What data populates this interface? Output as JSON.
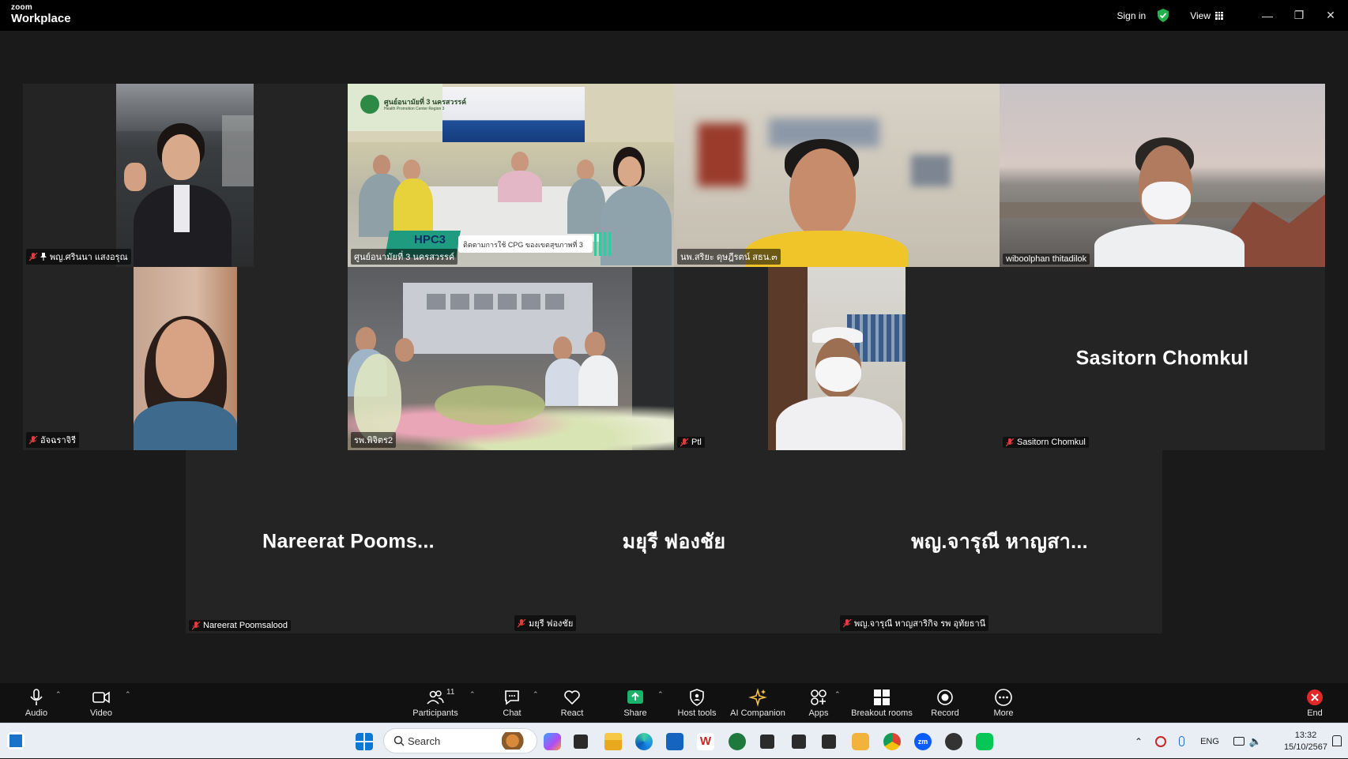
{
  "app": {
    "brand_top": "zoom",
    "brand_bottom": "Workplace"
  },
  "titlebar": {
    "sign_in": "Sign in",
    "view": "View"
  },
  "tiles": [
    {
      "name": "พญ.ศรินนา แสงอรุณ",
      "muted": true,
      "pinned": true
    },
    {
      "name": "ศูนย์อนามัยที่ 3 นครสวรรค์",
      "muted": false,
      "speaking": true,
      "banner_main": "HPC3",
      "banner_sub": "ติดตามการใช้ CPG ของเขตสุขภาพที่ 3",
      "room_sign": "ศูนย์อนามัยที่ 3 นครสวรรค์",
      "room_sign_en": "Health Promotion Center Region 3"
    },
    {
      "name": "นพ.สริยะ ดุษฎีรตน์ สธน.๓",
      "muted": false
    },
    {
      "name": "wiboolphan thitadilok",
      "muted": false
    },
    {
      "name": "อัจฉราจิรี",
      "muted": true
    },
    {
      "name": "รพ.พิจิตร2",
      "muted": false
    },
    {
      "name": "Ptl",
      "muted": true
    },
    {
      "name": "Sasitorn Chomkul",
      "muted": true,
      "display": "Sasitorn Chomkul"
    },
    {
      "name": "Nareerat Poomsalood",
      "muted": true,
      "display": "Nareerat  Pooms..."
    },
    {
      "name": "มยุรี ฟองชัย",
      "muted": true,
      "display": "มยุรี ฟองชัย"
    },
    {
      "name": "พญ.จารุณี หาญสาริกิจ รพ อุทัยธานี",
      "muted": true,
      "display": "พญ.จารุณี หาญสา..."
    }
  ],
  "toolbar": {
    "audio": "Audio",
    "video": "Video",
    "participants": "Participants",
    "participants_count": "11",
    "chat": "Chat",
    "react": "React",
    "share": "Share",
    "host_tools": "Host tools",
    "ai_companion": "AI Companion",
    "apps": "Apps",
    "breakout_rooms": "Breakout rooms",
    "record": "Record",
    "more": "More",
    "end": "End"
  },
  "taskbar": {
    "search_placeholder": "Search",
    "language": "ENG",
    "time": "13:32",
    "date": "15/10/2567"
  },
  "colors": {
    "active_speaker": "#37c870",
    "share_green": "#19b36b",
    "end_red": "#e02828"
  }
}
